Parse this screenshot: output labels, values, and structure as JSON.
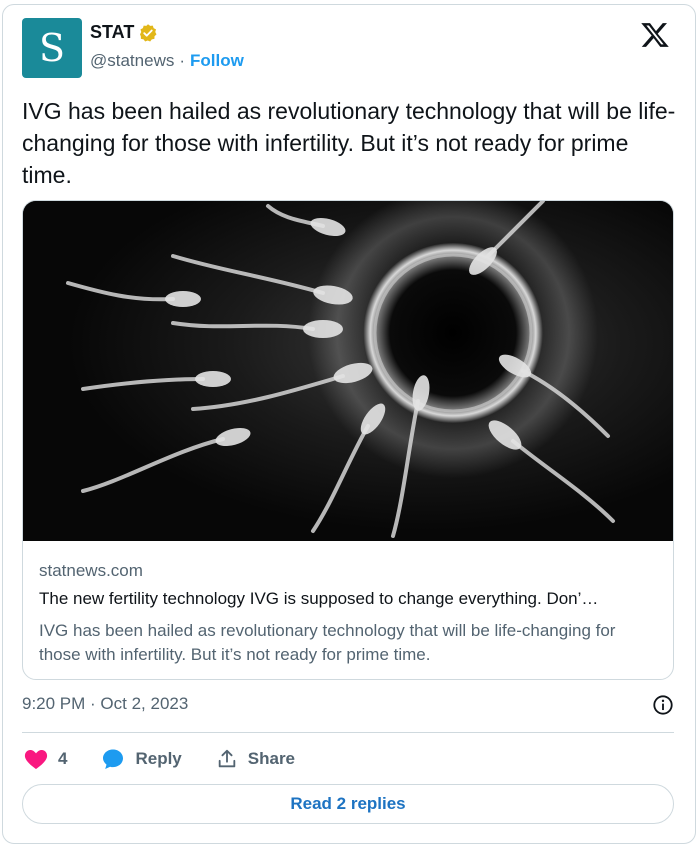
{
  "author": {
    "avatar_letter": "S",
    "name": "STAT",
    "handle": "@statnews",
    "separator": "·",
    "follow_label": "Follow",
    "avatar_color": "#1a8a99",
    "verified_color": "#e2b719"
  },
  "tweet": {
    "text": "IVG has been hailed as revolutionary technology that will be life-changing for those with infertility. But it’s not ready for prime time."
  },
  "link_card": {
    "image_icon": "sperm-and-egg-illustration",
    "domain": "statnews.com",
    "title": "The new fertility technology IVG is supposed to change everything. Don’…",
    "description": "IVG has been hailed as revolutionary technology that will be life-changing for those with infertility. But it’s not ready for prime time."
  },
  "meta": {
    "timestamp": "9:20 PM · Oct 2, 2023"
  },
  "actions": {
    "like_count": "4",
    "reply_label": "Reply",
    "share_label": "Share",
    "like_color": "#f91880",
    "reply_color": "#1d9bf0"
  },
  "footer": {
    "read_replies_label": "Read 2 replies"
  }
}
